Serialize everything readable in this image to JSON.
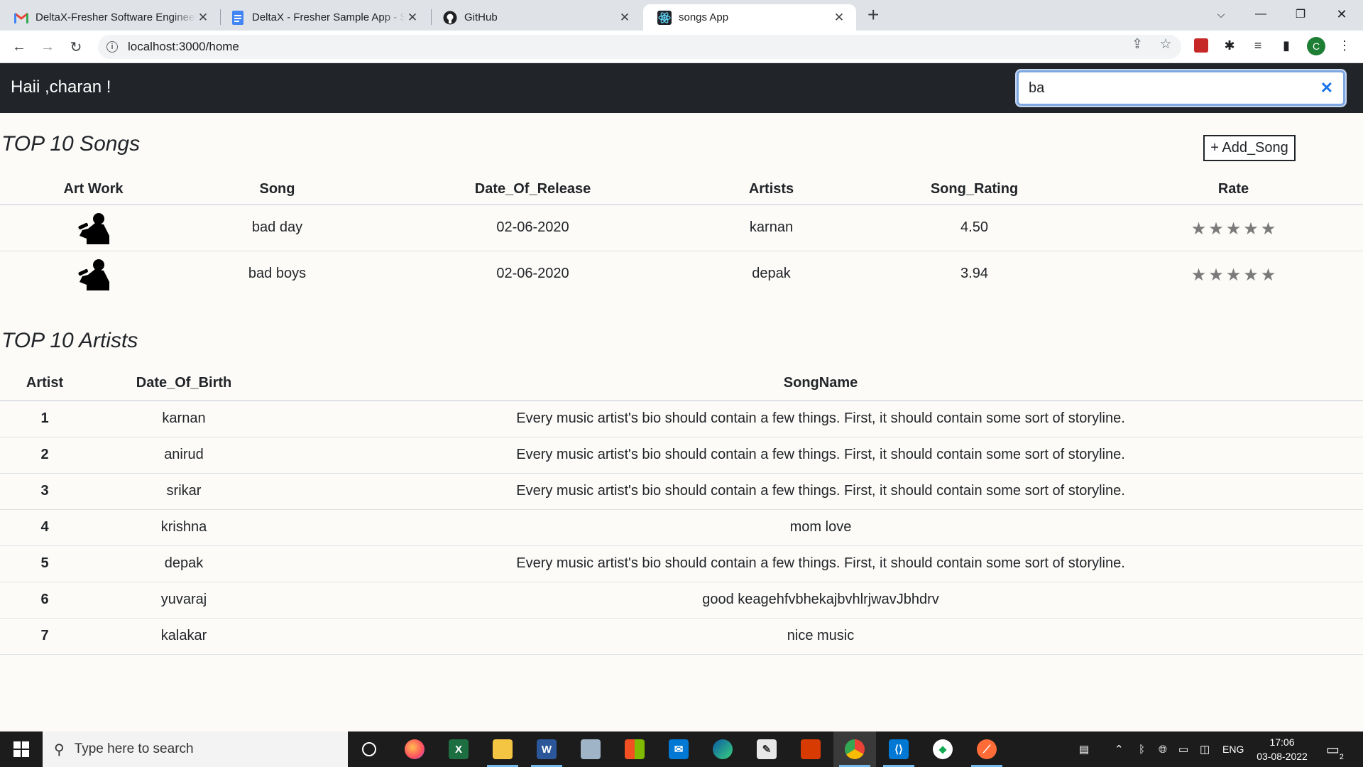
{
  "browser": {
    "tabs": [
      {
        "title": "DeltaX-Fresher Software Engineer",
        "favicon": "gmail-icon",
        "active": false
      },
      {
        "title": "DeltaX - Fresher Sample App - Spec",
        "favicon": "docs-icon",
        "active": false
      },
      {
        "title": "GitHub",
        "favicon": "github-icon",
        "active": false
      },
      {
        "title": "songs App",
        "favicon": "react-icon",
        "active": true
      }
    ],
    "url": "localhost:3000/home"
  },
  "app": {
    "greeting": "Haii ,charan !",
    "search_value": "ba",
    "songs_section": {
      "title": "TOP 10 Songs",
      "add_button": "+ Add_Song",
      "columns": [
        "Art Work",
        "Song",
        "Date_Of_Release",
        "Artists",
        "Song_Rating",
        "Rate"
      ],
      "rows": [
        {
          "song": "bad day",
          "date": "02-06-2020",
          "artists": "karnan",
          "rating": "4.50",
          "stars": 5
        },
        {
          "song": "bad boys",
          "date": "02-06-2020",
          "artists": "depak",
          "rating": "3.94",
          "stars": 5
        }
      ]
    },
    "artists_section": {
      "title": "TOP 10 Artists",
      "columns": [
        "Artist",
        "Date_Of_Birth",
        "SongName"
      ],
      "rows": [
        {
          "artist": "1",
          "dob": "karnan",
          "songname": "Every music artist's bio should contain a few things. First, it should contain some sort of storyline."
        },
        {
          "artist": "2",
          "dob": "anirud",
          "songname": "Every music artist's bio should contain a few things. First, it should contain some sort of storyline."
        },
        {
          "artist": "3",
          "dob": "srikar",
          "songname": "Every music artist's bio should contain a few things. First, it should contain some sort of storyline."
        },
        {
          "artist": "4",
          "dob": "krishna",
          "songname": "mom love"
        },
        {
          "artist": "5",
          "dob": "depak",
          "songname": "Every music artist's bio should contain a few things. First, it should contain some sort of storyline."
        },
        {
          "artist": "6",
          "dob": "yuvaraj",
          "songname": "good keagehfvbhekajbvhlrjwavJbhdrv"
        },
        {
          "artist": "7",
          "dob": "kalakar",
          "songname": "nice music"
        }
      ]
    }
  },
  "taskbar": {
    "search_placeholder": "Type here to search",
    "language": "ENG",
    "time": "17:06",
    "date": "03-08-2022",
    "notification_count": "2"
  },
  "colors": {
    "header_bg": "#212529",
    "page_bg": "#fdfbf8",
    "star": "#7a7a7a"
  }
}
